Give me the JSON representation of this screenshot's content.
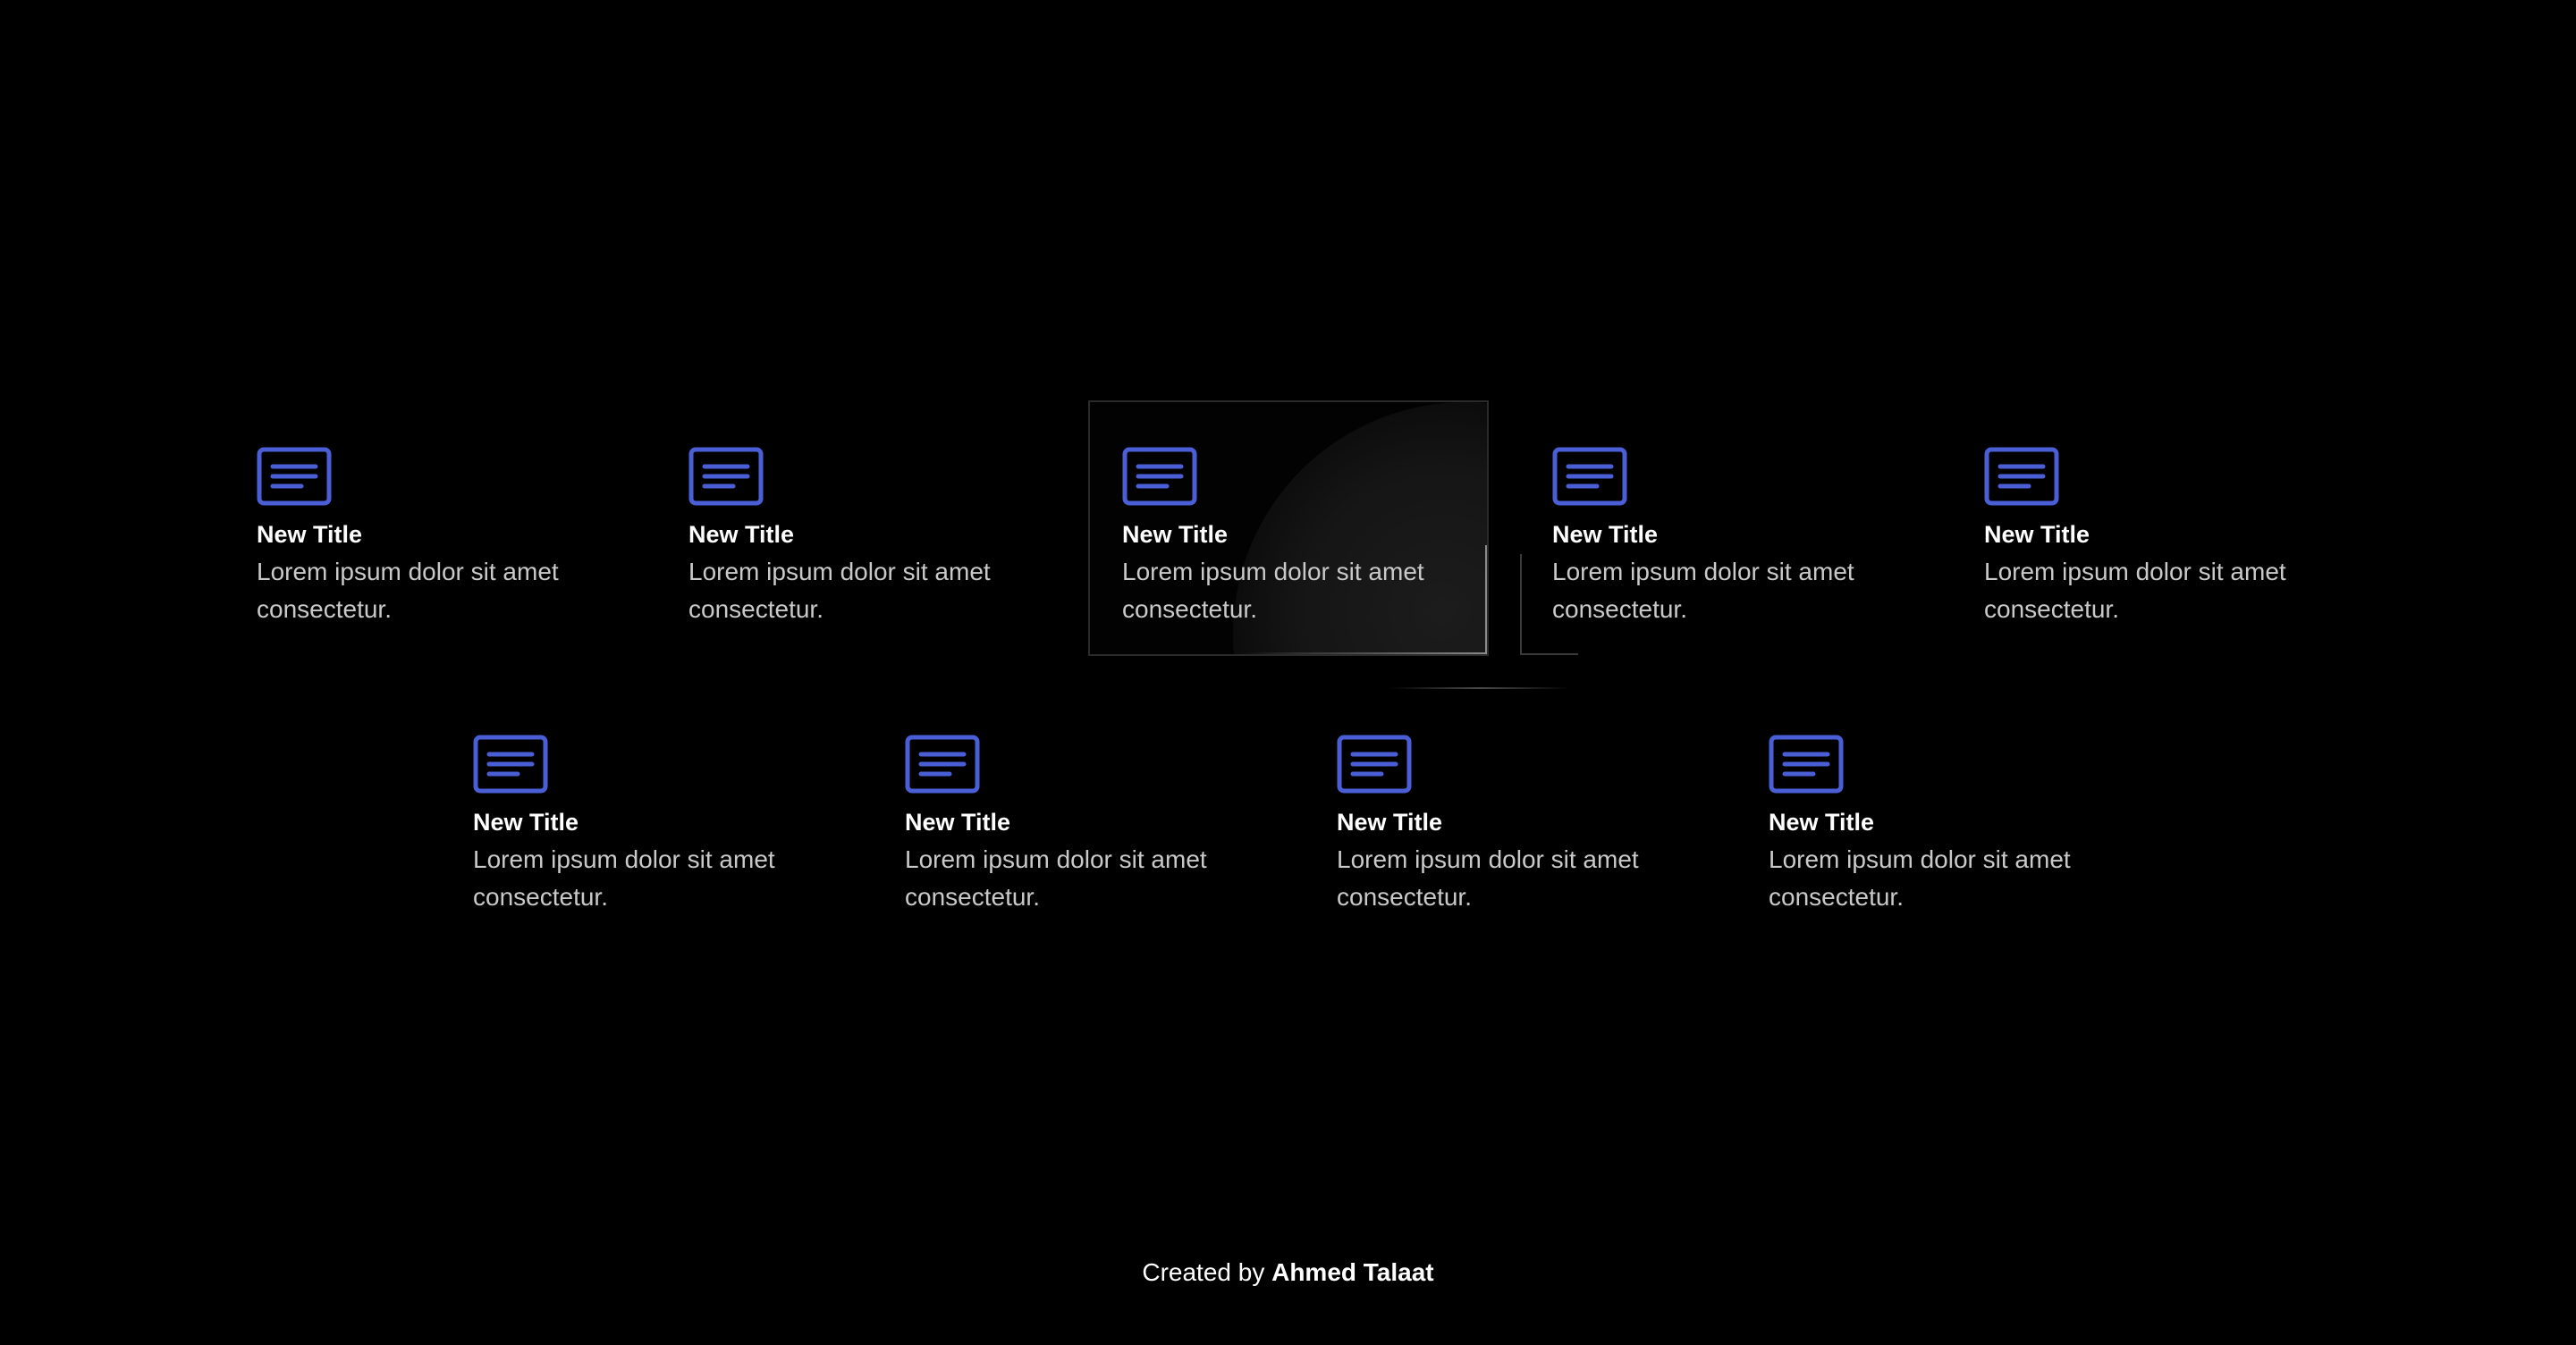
{
  "accent_color": "#4a5fd6",
  "cards": [
    {
      "icon": "document-icon",
      "title": "New Title",
      "text": "Lorem ipsum dolor sit amet consectetur."
    },
    {
      "icon": "document-icon",
      "title": "New Title",
      "text": "Lorem ipsum dolor sit amet consectetur."
    },
    {
      "icon": "document-icon",
      "title": "New Title",
      "text": "Lorem ipsum dolor sit amet consectetur."
    },
    {
      "icon": "document-icon",
      "title": "New Title",
      "text": "Lorem ipsum dolor sit amet consectetur."
    },
    {
      "icon": "document-icon",
      "title": "New Title",
      "text": "Lorem ipsum dolor sit amet consectetur."
    },
    {
      "icon": "document-icon",
      "title": "New Title",
      "text": "Lorem ipsum dolor sit amet consectetur."
    },
    {
      "icon": "document-icon",
      "title": "New Title",
      "text": "Lorem ipsum dolor sit amet consectetur."
    },
    {
      "icon": "document-icon",
      "title": "New Title",
      "text": "Lorem ipsum dolor sit amet consectetur."
    },
    {
      "icon": "document-icon",
      "title": "New Title",
      "text": "Lorem ipsum dolor sit amet consectetur."
    }
  ],
  "footer": {
    "prefix": "Created by",
    "author": "Ahmed Talaat"
  }
}
